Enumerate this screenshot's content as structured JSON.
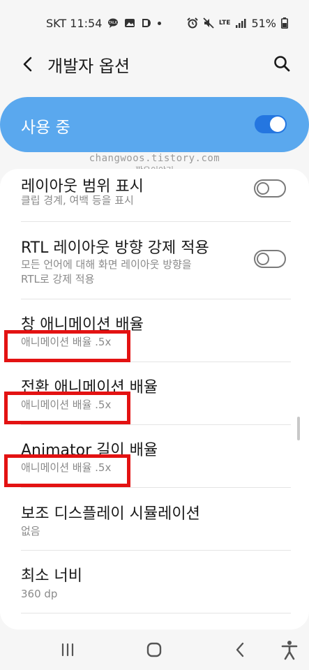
{
  "status_bar": {
    "carrier_time": "SKT 11:54",
    "network": "LTE",
    "battery": "51%"
  },
  "app_bar": {
    "title": "개발자 옵션",
    "back_icon": "back-arrow-icon",
    "search_icon": "search-icon"
  },
  "master_switch": {
    "label": "사용 중",
    "enabled": true,
    "colors": {
      "background": "#5aa8ee",
      "toggle": "#2476e0"
    }
  },
  "watermark": {
    "line1": "changwoos.tistory.com",
    "line2": "짱우이야기"
  },
  "settings": [
    {
      "title": "레이아웃 범위 표시",
      "sub": "클립 경계, 여백 등을 표시",
      "toggle": false
    },
    {
      "title": "RTL 레이아웃 방향 강제 적용",
      "sub": "모든 언어에 대해 화면 레이아웃 방향을",
      "sub2": "RTL로 강제 적용",
      "toggle": false
    },
    {
      "title": "창 애니메이션 배율",
      "sub": "애니메이션 배율 .5x",
      "highlighted": true
    },
    {
      "title": "전환 애니메이션 배율",
      "sub": "애니메이션 배율 .5x",
      "highlighted": true
    },
    {
      "title": "Animator 길이 배율",
      "sub": "애니메이션 배율 .5x",
      "highlighted": true
    },
    {
      "title": "보조 디스플레이 시뮬레이션",
      "sub": "없음"
    },
    {
      "title": "최소 너비",
      "sub": "360 dp"
    }
  ],
  "highlight_color": "#e31212",
  "nav_bar": {
    "recents_icon": "recents-icon",
    "home_icon": "home-icon",
    "back_icon": "nav-back-icon",
    "accessibility_icon": "accessibility-icon"
  }
}
